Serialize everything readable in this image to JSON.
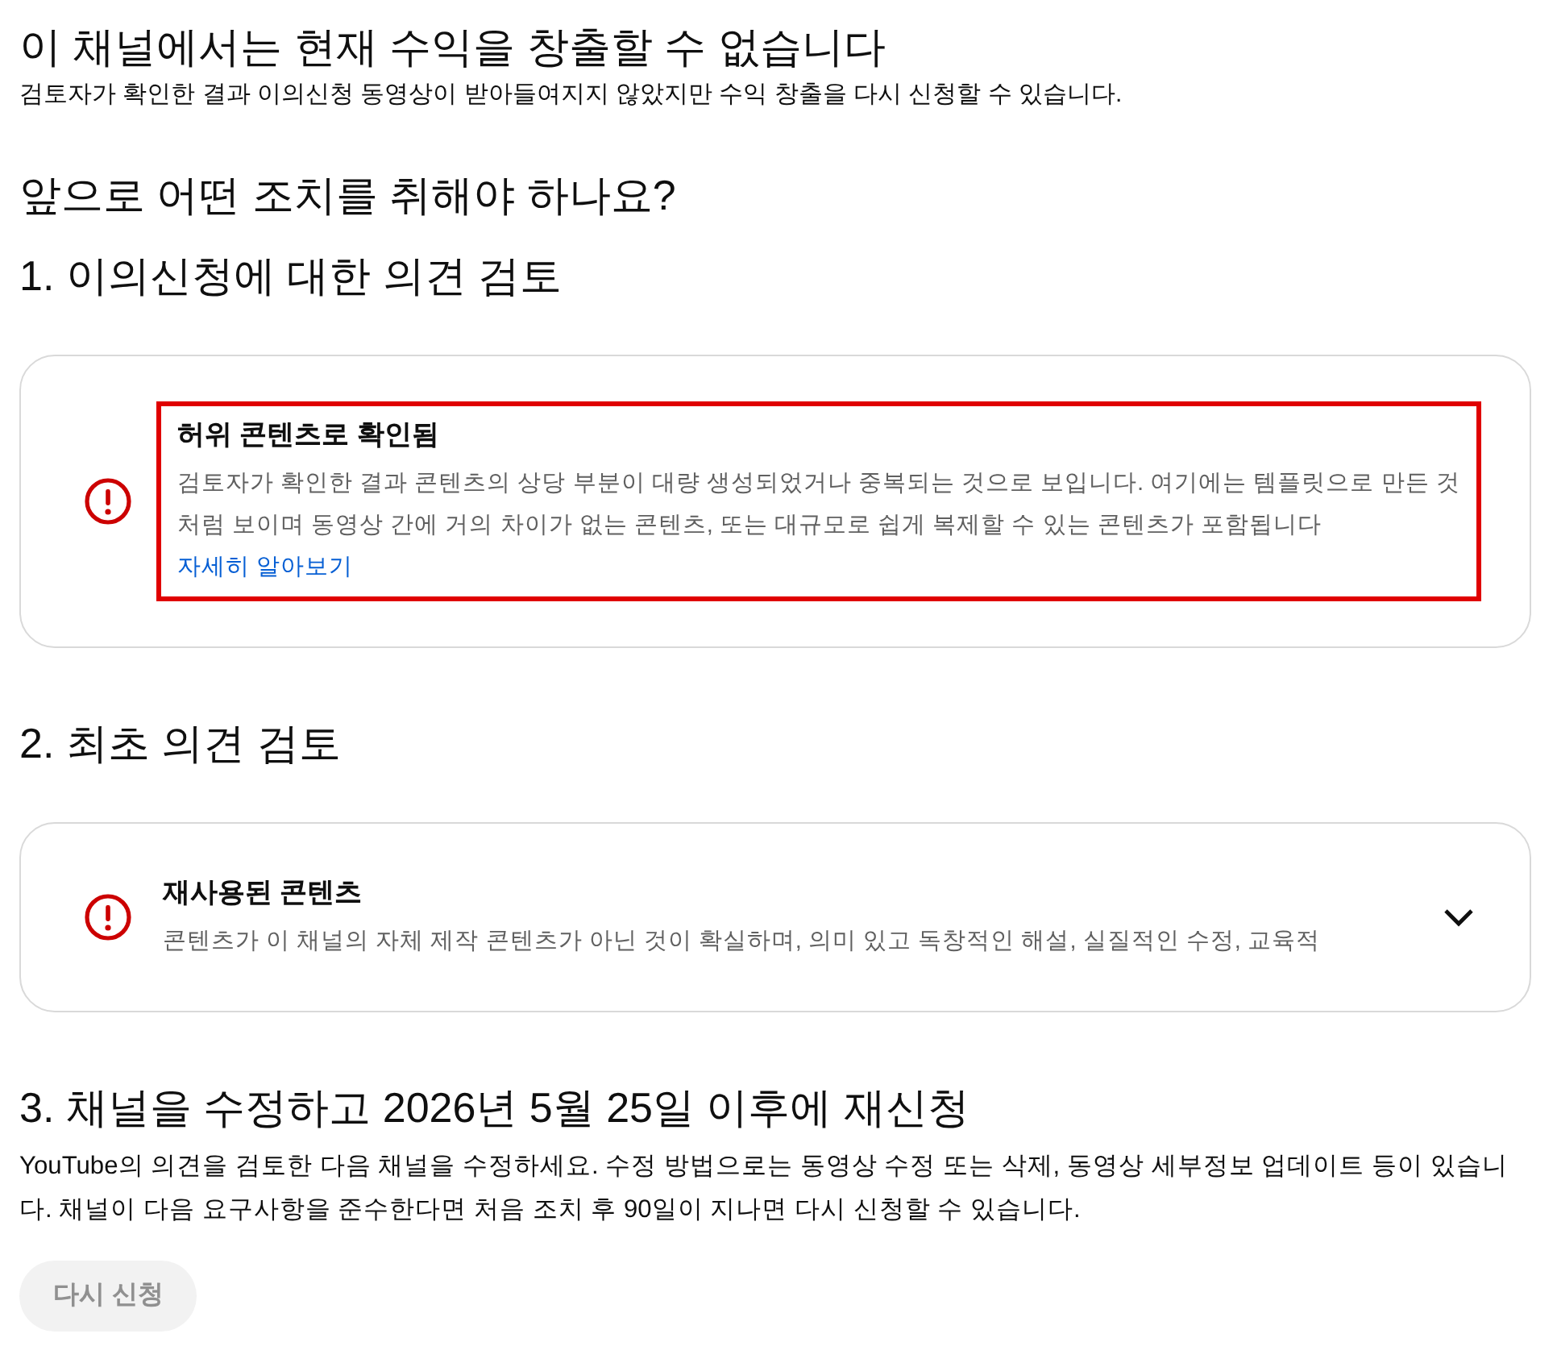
{
  "page": {
    "title": "이 채널에서는 현재 수익을 창출할 수 없습니다",
    "subtitle": "검토자가 확인한 결과 이의신청 동영상이 받아들여지지 않았지만 수익 창출을 다시 신청할 수 있습니다."
  },
  "next_steps_heading": "앞으로 어떤 조치를 취해야 하나요?",
  "steps": [
    {
      "heading": "1. 이의신청에 대한 의견 검토",
      "card": {
        "title": "허위 콘텐츠로 확인됨",
        "body": "검토자가 확인한 결과 콘텐츠의 상당 부분이 대량 생성되었거나 중복되는 것으로 보입니다. 여기에는 템플릿으로 만든 것처럼 보이며 동영상 간에 거의 차이가 없는 콘텐츠, 또는 대규모로 쉽게 복제할 수 있는 콘텐츠가 포함됩니다",
        "link": "자세히 알아보기",
        "highlighted": true,
        "expandable": false
      }
    },
    {
      "heading": "2. 최초 의견 검토",
      "card": {
        "title": "재사용된 콘텐츠",
        "body": "콘텐츠가 이 채널의 자체 제작 콘텐츠가 아닌 것이 확실하며, 의미 있고 독창적인 해설, 실질적인 수정, 교육적",
        "highlighted": false,
        "expandable": true
      }
    },
    {
      "heading": "3. 채널을 수정하고 2026년 5월 25일 이후에 재신청",
      "text": "YouTube의 의견을 검토한 다음 채널을 수정하세요. 수정 방법으로는 동영상 수정 또는 삭제, 동영상 세부정보 업데이트 등이 있습니다. 채널이 다음 요구사항을 준수한다면 처음 조치 후 90일이 지나면 다시 신청할 수 있습니다.",
      "button": {
        "label": "다시 신청",
        "disabled": true
      }
    }
  ]
}
